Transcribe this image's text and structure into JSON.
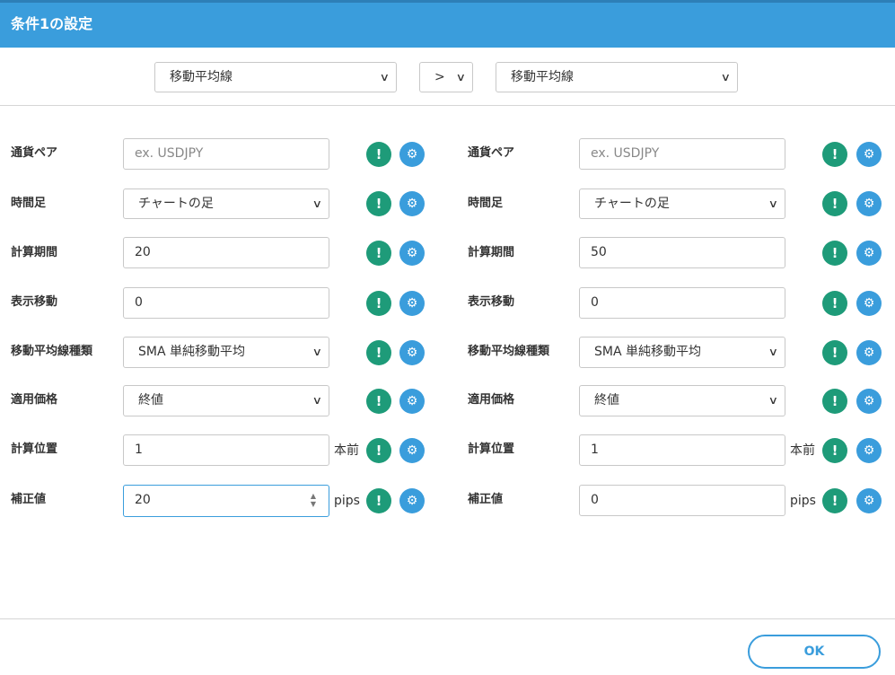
{
  "header": {
    "title": "条件1の設定"
  },
  "top": {
    "left_select": "移動平均線",
    "operator": ">",
    "right_select": "移動平均線"
  },
  "left": {
    "currency_pair": {
      "label": "通貨ペア",
      "placeholder": "ex. USDJPY"
    },
    "timeframe": {
      "label": "時間足",
      "value": "チャートの足"
    },
    "period": {
      "label": "計算期間",
      "value": "20"
    },
    "shift": {
      "label": "表示移動",
      "value": "0"
    },
    "ma_type": {
      "label": "移動平均線種類",
      "value": "SMA 単純移動平均"
    },
    "price": {
      "label": "適用価格",
      "value": "終値"
    },
    "position": {
      "label": "計算位置",
      "value": "1",
      "suffix": "本前"
    },
    "offset": {
      "label": "補正値",
      "value": "20",
      "suffix": "pips"
    }
  },
  "right": {
    "currency_pair": {
      "label": "通貨ペア",
      "placeholder": "ex. USDJPY"
    },
    "timeframe": {
      "label": "時間足",
      "value": "チャートの足"
    },
    "period": {
      "label": "計算期間",
      "value": "50"
    },
    "shift": {
      "label": "表示移動",
      "value": "0"
    },
    "ma_type": {
      "label": "移動平均線種類",
      "value": "SMA 単純移動平均"
    },
    "price": {
      "label": "適用価格",
      "value": "終値"
    },
    "position": {
      "label": "計算位置",
      "value": "1",
      "suffix": "本前"
    },
    "offset": {
      "label": "補正値",
      "value": "0",
      "suffix": "pips"
    }
  },
  "icons": {
    "info": "!",
    "settings": "⚙",
    "chevron": "∨",
    "spin_up": "▲",
    "spin_down": "▼"
  },
  "footer": {
    "ok_label": "OK"
  },
  "colors": {
    "accent": "#3a9ddc",
    "info_green": "#1e9b79"
  }
}
